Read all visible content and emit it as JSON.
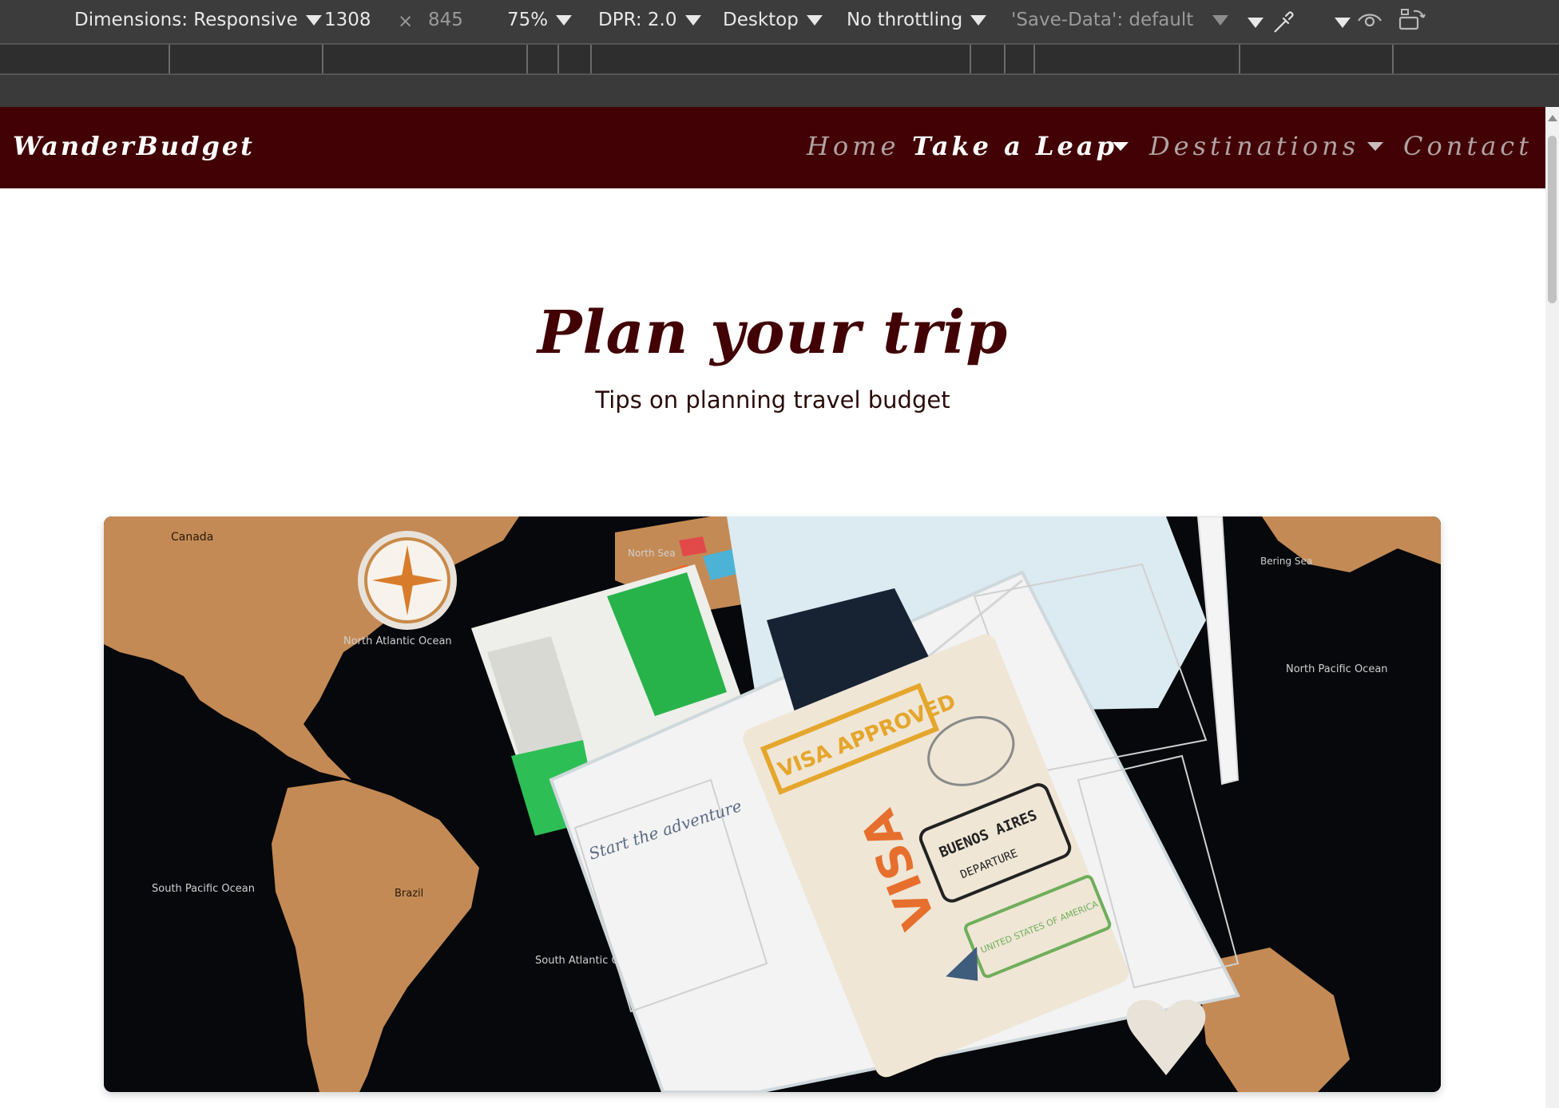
{
  "devtools": {
    "dimensions_label": "Dimensions: Responsive",
    "width_value": "1308",
    "times_sign": "×",
    "height_value": "845",
    "zoom": "75%",
    "dpr": "DPR: 2.0",
    "device_type": "Desktop",
    "throttling": "No throttling",
    "save_data": "'Save-Data': default"
  },
  "site": {
    "brand": "WanderBudget",
    "nav": {
      "home": "Home",
      "take_a_leap": "Take a Leap",
      "destinations": "Destinations",
      "contact": "Contact"
    },
    "hero": {
      "title": "Plan your trip",
      "subtitle": "Tips on planning travel budget"
    },
    "image": {
      "map_labels": {
        "canada": "Canada",
        "north_atlantic": "North Atlantic Ocean",
        "north_pacific": "North Pacific Ocean",
        "south_pacific": "South Pacific Ocean",
        "south_atlantic": "South Atlantic Ocean",
        "brazil": "Brazil",
        "north_sea": "North Sea",
        "bering_sea": "Bering Sea"
      },
      "passport_stamps": {
        "visa_approved": "VISA APPROVED",
        "visa": "VISA",
        "buenos_aires": "BUENOS AIRES",
        "departure": "DEPARTURE",
        "usa": "UNITED STATES OF AMERICA"
      },
      "planner_note": "Start the adventure"
    }
  },
  "colors": {
    "brand_primary": "#420205",
    "nav_inactive": "#b0a3a3",
    "devtools_bg": "#3c3c3c"
  }
}
